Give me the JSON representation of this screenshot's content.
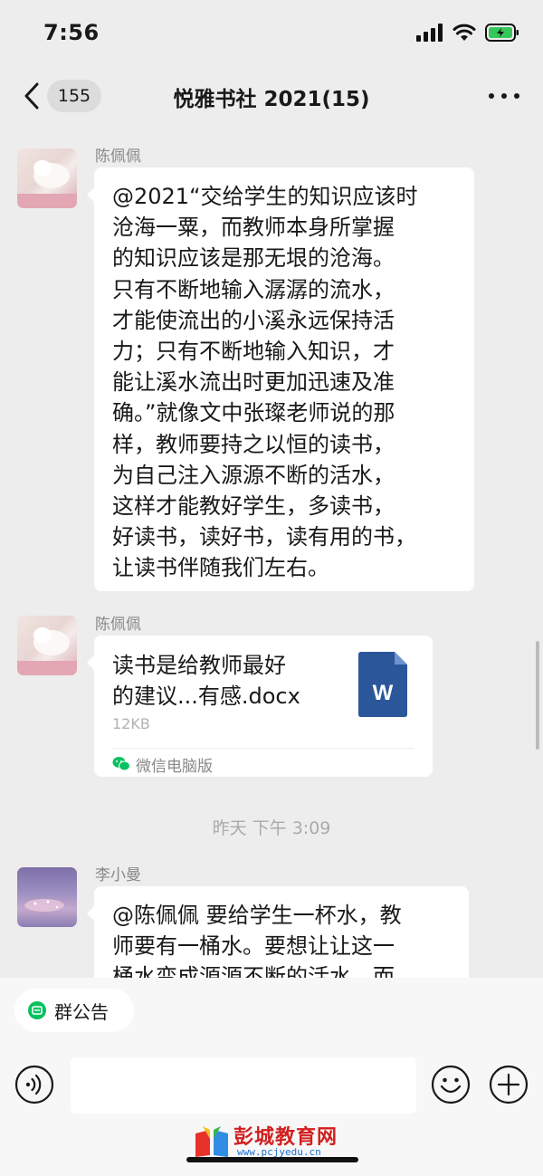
{
  "status_bar": {
    "time": "7:56"
  },
  "nav": {
    "unread_count": "155",
    "title": "悦雅书社 2021(15)"
  },
  "messages": [
    {
      "sender": "陈佩佩",
      "type": "text",
      "lines": [
        "@2021“交给学生的知识应该时",
        "沧海一粟，而教师本身所掌握",
        "的知识应该是那无垠的沧海。",
        "只有不断地输入潺潺的流水，",
        "才能使流出的小溪永远保持活",
        "力；只有不断地输入知识，才",
        "能让溪水流出时更加迅速及准",
        "确。”就像文中张璨老师说的那",
        "样，教师要持之以恒的读书，",
        "为自己注入源源不断的活水，",
        "这样才能教好学生，多读书，",
        "好读书，读好书，读有用的书，",
        "让读书伴随我们左右。"
      ]
    },
    {
      "sender": "陈佩佩",
      "type": "file",
      "file_name_lines": [
        "读书是给教师最好",
        "的建议...有感.docx"
      ],
      "file_icon_letter": "W",
      "file_size": "12KB",
      "source": "微信电脑版"
    },
    {
      "sender": "李小曼",
      "type": "text",
      "lines": [
        "@陈佩佩 要给学生一杯水，教",
        "师要有一桶水。要想让让这一",
        "桶水变成源源不断的活水，而"
      ]
    }
  ],
  "timestamp": "昨天 下午 3:09",
  "bottom": {
    "notice_label": "群公告",
    "input_placeholder": ""
  },
  "watermark": {
    "text": "彭城教育网",
    "url": "www.pcjyedu.cn"
  },
  "colors": {
    "background": "#ededed",
    "bubble": "#ffffff",
    "word_blue": "#2b579a",
    "wechat_green": "#07c160"
  }
}
